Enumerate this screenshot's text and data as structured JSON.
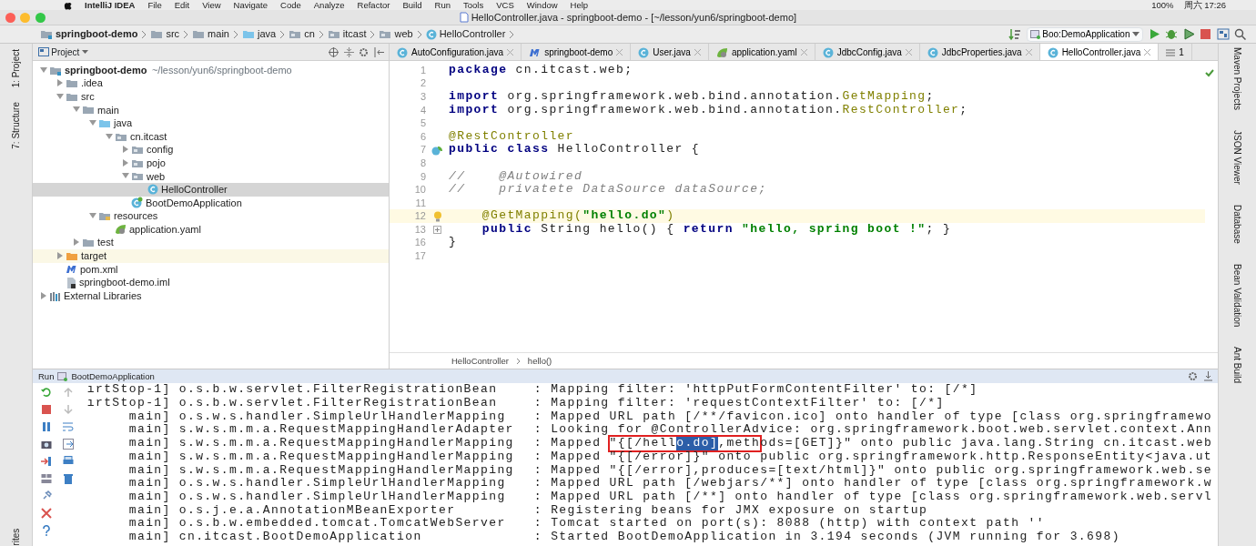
{
  "menu_bar": {
    "app": "IntelliJ IDEA",
    "items": [
      "File",
      "Edit",
      "View",
      "Navigate",
      "Code",
      "Analyze",
      "Refactor",
      "Build",
      "Run",
      "Tools",
      "VCS",
      "Window",
      "Help"
    ],
    "battery": "100%",
    "clock": "周六 17:26"
  },
  "window": {
    "title": "HelloController.java - springboot-demo - [~/lesson/yun6/springboot-demo]"
  },
  "nav_bar": {
    "crumbs": [
      {
        "label": "springboot-demo",
        "kind": "module"
      },
      {
        "label": "src",
        "kind": "folder"
      },
      {
        "label": "main",
        "kind": "folder"
      },
      {
        "label": "java",
        "kind": "source"
      },
      {
        "label": "cn",
        "kind": "package"
      },
      {
        "label": "itcast",
        "kind": "package"
      },
      {
        "label": "web",
        "kind": "package"
      },
      {
        "label": "HelloController",
        "kind": "class"
      }
    ],
    "run_config": "Boo:DemoApplication"
  },
  "left_strip": [
    "1: Project",
    "7: Structure",
    "rites"
  ],
  "right_strip": [
    "Maven Projects",
    "JSON Viewer",
    "Database",
    "Bean Validation",
    "Ant Build"
  ],
  "project": {
    "title": "Project",
    "tree": [
      {
        "name": "springboot-demo",
        "path": "~/lesson/yun6/springboot-demo",
        "kind": "module",
        "expanded": true,
        "selected": false,
        "children": [
          {
            "name": ".idea",
            "kind": "folder",
            "expanded": false,
            "selected": false
          },
          {
            "name": "src",
            "kind": "folder",
            "expanded": true,
            "selected": false,
            "children": [
              {
                "name": "main",
                "kind": "folder",
                "expanded": true,
                "selected": false,
                "children": [
                  {
                    "name": "java",
                    "kind": "source",
                    "expanded": true,
                    "selected": false,
                    "children": [
                      {
                        "name": "cn.itcast",
                        "kind": "package",
                        "expanded": true,
                        "selected": false,
                        "children": [
                          {
                            "name": "config",
                            "kind": "package",
                            "expanded": false,
                            "selected": false
                          },
                          {
                            "name": "pojo",
                            "kind": "package",
                            "expanded": false,
                            "selected": false
                          },
                          {
                            "name": "web",
                            "kind": "package",
                            "expanded": true,
                            "selected": false,
                            "children": [
                              {
                                "name": "HelloController",
                                "kind": "class",
                                "selected": true
                              }
                            ]
                          },
                          {
                            "name": "BootDemoApplication",
                            "kind": "spring-class",
                            "selected": false
                          }
                        ]
                      }
                    ]
                  },
                  {
                    "name": "resources",
                    "kind": "resources",
                    "expanded": true,
                    "selected": false,
                    "children": [
                      {
                        "name": "application.yaml",
                        "kind": "yaml",
                        "selected": false
                      }
                    ]
                  }
                ]
              },
              {
                "name": "test",
                "kind": "folder",
                "expanded": false,
                "selected": false
              }
            ]
          },
          {
            "name": "target",
            "kind": "excluded",
            "expanded": false,
            "selected": false
          },
          {
            "name": "pom.xml",
            "kind": "maven",
            "selected": false
          },
          {
            "name": "springboot-demo.iml",
            "kind": "iml",
            "selected": false
          }
        ]
      },
      {
        "name": "External Libraries",
        "kind": "libraries",
        "expanded": false,
        "selected": false
      }
    ]
  },
  "editor": {
    "tabs": [
      {
        "label": "AutoConfiguration.java",
        "kind": "class",
        "selected": false
      },
      {
        "label": "springboot-demo",
        "kind": "maven",
        "selected": false
      },
      {
        "label": "User.java",
        "kind": "class",
        "selected": false
      },
      {
        "label": "application.yaml",
        "kind": "yaml",
        "selected": false
      },
      {
        "label": "JdbcConfig.java",
        "kind": "class",
        "selected": false
      },
      {
        "label": "JdbcProperties.java",
        "kind": "class",
        "selected": false
      },
      {
        "label": "HelloController.java",
        "kind": "class",
        "selected": true
      }
    ],
    "tab_count": "1",
    "lines": [
      {
        "number": "1",
        "tokens": [
          {
            "text": "package",
            "kind": "keyword"
          },
          {
            "text": " cn.itcast.web;",
            "kind": "plain"
          }
        ]
      },
      {
        "number": "2"
      },
      {
        "number": "3",
        "tokens": [
          {
            "text": "import",
            "kind": "keyword"
          },
          {
            "text": " org.springframework.web.bind.annotation.",
            "kind": "plain"
          },
          {
            "text": "GetMapping",
            "kind": "annotation"
          },
          {
            "text": ";",
            "kind": "plain"
          }
        ]
      },
      {
        "number": "4",
        "tokens": [
          {
            "text": "import",
            "kind": "keyword"
          },
          {
            "text": " org.springframework.web.bind.annotation.",
            "kind": "plain"
          },
          {
            "text": "RestController",
            "kind": "annotation"
          },
          {
            "text": ";",
            "kind": "plain"
          }
        ]
      },
      {
        "number": "5"
      },
      {
        "number": "6",
        "tokens": [
          {
            "text": "@RestController",
            "kind": "annotation"
          }
        ]
      },
      {
        "number": "7",
        "gutter": {
          "kind": "bean"
        },
        "tokens": [
          {
            "text": "public class",
            "kind": "keyword"
          },
          {
            "text": " HelloController {",
            "kind": "plain"
          }
        ]
      },
      {
        "number": "8"
      },
      {
        "number": "9",
        "tokens": [
          {
            "text": "//    @Autowired",
            "kind": "comment"
          }
        ]
      },
      {
        "number": "10",
        "tokens": [
          {
            "text": "//    privatete DataSource dataSource;",
            "kind": "comment"
          }
        ]
      },
      {
        "number": "11"
      },
      {
        "number": "12",
        "gutter": {
          "kind": "bulb"
        },
        "current": true,
        "tokens": [
          {
            "text": "    @GetMapping(",
            "kind": "annotation"
          },
          {
            "text": "\"hello.do\"",
            "kind": "string"
          },
          {
            "text": ")",
            "kind": "annotation"
          }
        ]
      },
      {
        "number": "13",
        "gutter": {
          "kind": "fold"
        },
        "tokens": [
          {
            "text": "    public",
            "kind": "keyword"
          },
          {
            "text": " String hello() { ",
            "kind": "plain"
          },
          {
            "text": "return",
            "kind": "keyword"
          },
          {
            "text": " \"hello, spring boot !\"",
            "kind": "string"
          },
          {
            "text": "; }",
            "kind": "plain"
          }
        ]
      },
      {
        "number": "16",
        "tokens": [
          {
            "text": "}",
            "kind": "plain"
          }
        ]
      },
      {
        "number": "17"
      }
    ],
    "breadcrumbs": [
      "HelloController",
      "hello()"
    ]
  },
  "run_panel": {
    "label": "Run",
    "config": "BootDemoApplication",
    "lines": [
      {
        "thread": "ırtStop-1]",
        "logger": "o.s.b.w.servlet.FilterRegistrationBean",
        "message": ": Mapping filter: 'httpPutFormContentFilter' to: [/*]"
      },
      {
        "thread": "ırtStop-1]",
        "logger": "o.s.b.w.servlet.FilterRegistrationBean",
        "message": ": Mapping filter: 'requestContextFilter' to: [/*]"
      },
      {
        "thread": "main]",
        "logger": "o.s.w.s.handler.SimpleUrlHandlerMapping",
        "message": ": Mapped URL path [/**/favicon.ico] onto handler of type [class org.springframewo"
      },
      {
        "thread": "main]",
        "logger": "s.w.s.m.m.a.RequestMappingHandlerAdapter",
        "message": ": Looking for @ControllerAdvice: org.springframework.boot.web.servlet.context.Ann"
      },
      {
        "thread": "main]",
        "logger": "s.w.s.m.m.a.RequestMappingHandlerMapping",
        "segments": [
          {
            "text": ": Mapped ",
            "boxed": false,
            "selected": false
          },
          {
            "text": "\"{[/hell",
            "boxed": true,
            "selected": false
          },
          {
            "text": "o.do]",
            "boxed": true,
            "selected": true
          },
          {
            "text": ",meth",
            "boxed": true,
            "selected": false
          },
          {
            "text": "ods=[GET]}\" onto public java.lang.String cn.itcast.web",
            "boxed": false,
            "selected": false
          }
        ]
      },
      {
        "thread": "main]",
        "logger": "s.w.s.m.m.a.RequestMappingHandlerMapping",
        "message": ": Mapped \"{[/error]}\" onto public org.springframework.http.ResponseEntity<java.ut"
      },
      {
        "thread": "main]",
        "logger": "s.w.s.m.m.a.RequestMappingHandlerMapping",
        "message": ": Mapped \"{[/error],produces=[text/html]}\" onto public org.springframework.web.se"
      },
      {
        "thread": "main]",
        "logger": "o.s.w.s.handler.SimpleUrlHandlerMapping",
        "message": ": Mapped URL path [/webjars/**] onto handler of type [class org.springframework.w"
      },
      {
        "thread": "main]",
        "logger": "o.s.w.s.handler.SimpleUrlHandlerMapping",
        "message": ": Mapped URL path [/**] onto handler of type [class org.springframework.web.servl"
      },
      {
        "thread": "main]",
        "logger": "o.s.j.e.a.AnnotationMBeanExporter",
        "message": ": Registering beans for JMX exposure on startup"
      },
      {
        "thread": "main]",
        "logger": "o.s.b.w.embedded.tomcat.TomcatWebServer",
        "message": ": Tomcat started on port(s): 8088 (http) with context path ''"
      },
      {
        "thread": "main]",
        "logger": "cn.itcast.BootDemoApplication",
        "message": ": Started BootDemoApplication in 3.194 seconds (JVM running for 3.698)"
      }
    ]
  }
}
